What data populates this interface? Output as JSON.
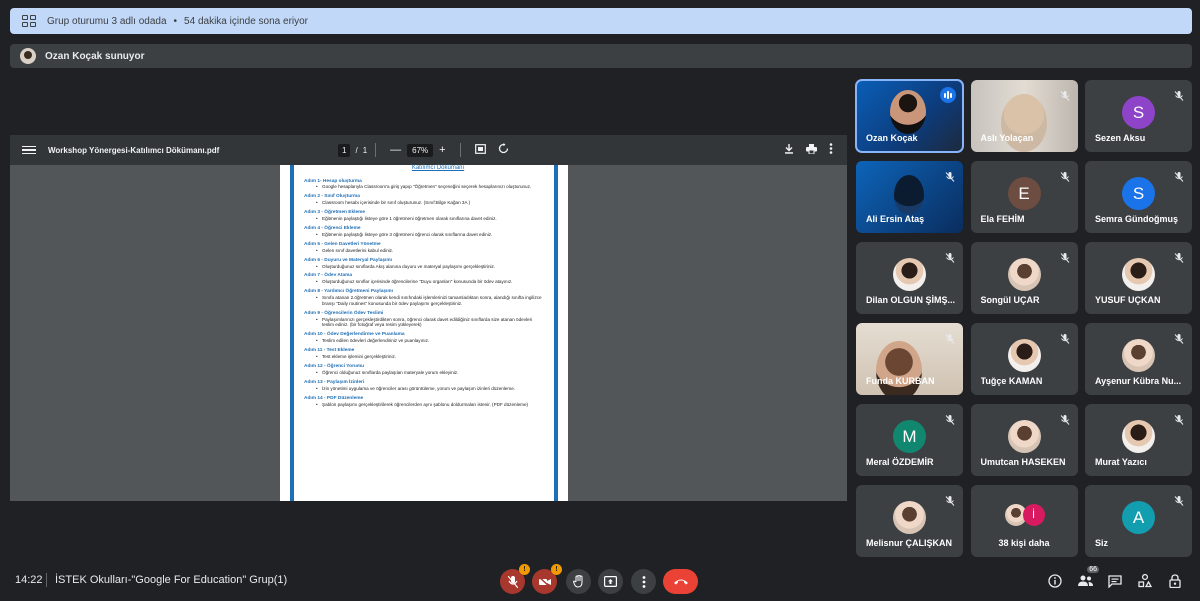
{
  "banner": {
    "text": "Grup oturumu 3 adlı odada",
    "separator": "•",
    "expiry": "54 dakika içinde sona eriyor"
  },
  "presenter": {
    "label": "Ozan Koçak sunuyor"
  },
  "pdf": {
    "filename": "Workshop Yönergesi-Katılımcı Dökümanı.pdf",
    "page_current": "1",
    "page_sep": "/",
    "page_total": "1",
    "zoom": "67%",
    "zoom_out": "—",
    "zoom_in": "+",
    "doc_title": "Katılımcı Dökümanı",
    "steps": [
      {
        "h": "Adım 1- Hesap oluşturma",
        "b": "Google hesaplarıyla Classroom'a giriş yapıp \"Öğretmen\" seçeneğini seçerek hesaplarınızı oluşturunuz."
      },
      {
        "h": "Adım 2 - Sınıf Oluşturma",
        "b": "Classroom hesabı içerisinde bir sınıf oluşturunuz. (Sınıf:Bilge Kağan 3A )"
      },
      {
        "h": "Adım 3 - Öğretmen Ekleme",
        "b": "Eğitmenin paylaştığı listeye göre 1 öğretmeni öğretmen olarak sınıflarına davet ediniz."
      },
      {
        "h": "Adım 4 - Öğrenci Ekleme",
        "b": "Eğitmenin paylaştığı listeye göre 3 öğretmeni öğrenci olarak sınıflarına davet ediniz."
      },
      {
        "h": "Adım 5 - Gelen Davetleri Yönetme",
        "b": "Gelen sınıf davetlerini kabul ediniz."
      },
      {
        "h": "Adım 6 - Duyuru ve Materyal Paylaşımı",
        "b": "Oluşturduğunuz sınıflarda Akış alanına duyuru ve materyal paylaşımı gerçekleştiriniz."
      },
      {
        "h": "Adım 7 - Ödev Atama",
        "b": "Oluşturduğunuz sınıflar içerisinde öğrencilerine \"Duyu organları\" konusunda bir ödev atayınız."
      },
      {
        "h": "Adım 8 - Yardımcı Öğretmeni Paylaşımı",
        "b": "Sınıfa atanan 2.öğretmen olarak kendi sınıfındaki işlemlerinizi tamamladıktan sonra, alandığı sınıfta ingilizce branşı \"Daily routines\" konusunda bir ödev paylaşımı gerçekleştiriniz."
      },
      {
        "h": "Adım 9 - Öğrencilerin Ödev Teslimi",
        "b": "Paylaşımlarınızı gerçekleştirdikten sonra, öğrenci olarak davet edildiğiniz sınıflarda size atanan ödevleri teslim ediniz. (bir fotoğraf veya resim yükleyerek)"
      },
      {
        "h": "Adım 10 - Ödev Değerlendirme ve Puanlama",
        "b": "Teslim edilen ödevleri değerlendiriniz ve puanlayınız."
      },
      {
        "h": "Adım 11 - Test Ekleme",
        "b": "Test ekleme işlemini gerçekleştiriniz."
      },
      {
        "h": "Adım 12 - Öğrenci Yorumu",
        "b": "Öğrenci olduğunuz sınıflarda paylaşılan materyale yorum ekleyiniz."
      },
      {
        "h": "Adım 13 - Paylaşım İzinleri",
        "b": "İzin yönetimi uygulama ve öğrenciler arası görüntüleme, yorum ve paylaşım izinleri düzenleme."
      },
      {
        "h": "Adım 14 - PDF Düzenleme",
        "b": "Şablon paylaşımı gerçekleştirilerek öğrencilerden aynı şablonu doldurmaları istenir. (PDF düzenleme)"
      }
    ]
  },
  "participants": [
    {
      "name": "Ozan Koçak",
      "type": "video",
      "speaking": true
    },
    {
      "name": "Aslı Yolaçan",
      "type": "video"
    },
    {
      "name": "Sezen Aksu",
      "type": "letter",
      "letter": "S",
      "color": "#8e44c8"
    },
    {
      "name": "Ali Ersin Ataş",
      "type": "video"
    },
    {
      "name": "Ela FEHİM",
      "type": "letter",
      "letter": "E",
      "color": "#6d4c41"
    },
    {
      "name": "Semra Gündoğmuş",
      "type": "letter",
      "letter": "S",
      "color": "#1a73e8"
    },
    {
      "name": "Dilan OLGUN ŞİMŞ...",
      "type": "photo"
    },
    {
      "name": "Songül UÇAR",
      "type": "photo"
    },
    {
      "name": "YUSUF UÇKAN",
      "type": "photo"
    },
    {
      "name": "Funda KURBAN",
      "type": "video"
    },
    {
      "name": "Tuğçe KAMAN",
      "type": "photo"
    },
    {
      "name": "Ayşenur Kübra Nu...",
      "type": "photo"
    },
    {
      "name": "Meral ÖZDEMİR",
      "type": "letter",
      "letter": "M",
      "color": "#12876f"
    },
    {
      "name": "Umutcan HASEKEN",
      "type": "photo"
    },
    {
      "name": "Murat Yazıcı",
      "type": "photo"
    },
    {
      "name": "Melisnur ÇALIŞKAN",
      "type": "photo"
    },
    {
      "name": "38 kişi daha",
      "type": "more",
      "letter": "İ"
    },
    {
      "name": "Siz",
      "type": "letter",
      "letter": "A",
      "color": "#129eaf"
    }
  ],
  "bottom": {
    "time": "14:22",
    "meeting": "İSTEK Okulları-\"Google For Education\" Grup(1)",
    "mic_badge": "!",
    "cam_badge": "!",
    "people_count": "66"
  },
  "icons": {
    "banner": "breakout-rooms-icon",
    "mic": "mic-off-icon",
    "cam": "camera-off-icon",
    "hand": "raise-hand-icon",
    "present": "present-screen-icon",
    "more": "more-vert-icon",
    "leave": "call-end-icon",
    "info": "info-icon",
    "people": "people-icon",
    "chat": "chat-icon",
    "activities": "activities-icon",
    "lock": "host-controls-icon"
  },
  "colors": {
    "accent": "#8ab4f8",
    "leave": "#ea4335",
    "banner_bg": "#c2d8f8",
    "muted_red": "#a8372e"
  }
}
